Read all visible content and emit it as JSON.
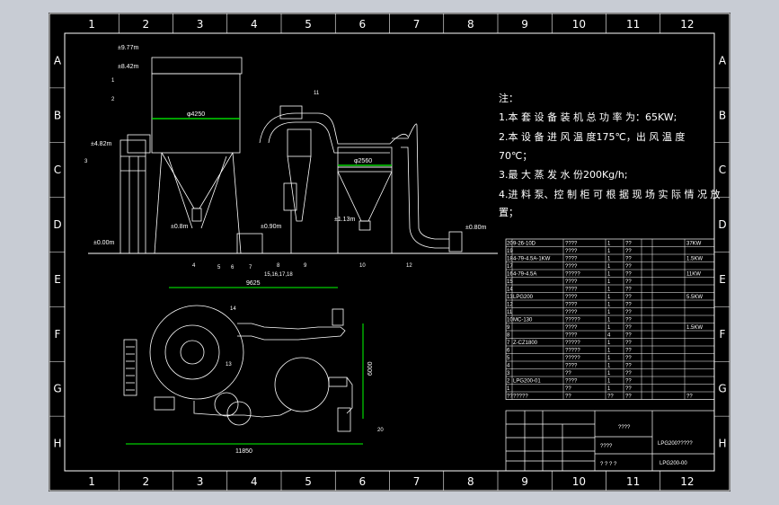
{
  "border": {
    "columns": [
      "1",
      "2",
      "3",
      "4",
      "5",
      "6",
      "7",
      "8",
      "9",
      "10",
      "11",
      "12"
    ],
    "rows": [
      "A",
      "B",
      "C",
      "D",
      "E",
      "F",
      "G",
      "H"
    ]
  },
  "elevations": {
    "e977": "±9.77m",
    "e842": "±8.42m",
    "e482": "±4.82m",
    "e000": "±0.00m",
    "e08a": "±0.8m",
    "e090": "±0.90m",
    "e113": "±1.13m",
    "e080": "±0.80m"
  },
  "dimensions": {
    "dia_dryer": "φ4250",
    "dia_tank": "φ2560",
    "len_top": "9625",
    "len_bottom": "11850",
    "height_side": "6000"
  },
  "callouts": {
    "c1a": "1",
    "c2": "2",
    "c3": "3",
    "c4": "4",
    "c5": "5",
    "c6": "6",
    "c7": "7",
    "c8": "8",
    "c9": "9",
    "c10": "10",
    "c11": "11",
    "c12": "12",
    "c13": "13",
    "c14": "14",
    "c15_18": "15,16,17,18",
    "c20": "20"
  },
  "notes": {
    "heading": "注：",
    "n1": "1.本 套 设 备 装 机 总 功 率 为：65KW;",
    "n2a": "2.本 设 备 进 风 温 度175℃，出 风 温 度",
    "n2b": "70℃；",
    "n3": "3.最 大 蒸 发 水 份200Kg/h;",
    "n4a": "4.进 料 泵、控 制 柜 可 根 据 现 场 实 际 情 况 放",
    "n4b": "置；"
  },
  "parts": [
    {
      "no": "20",
      "code": "9-26-10D",
      "name": "????",
      "qty": "1",
      "mat": "??",
      "note": "37KW"
    },
    {
      "no": "19",
      "code": "",
      "name": "????",
      "qty": "1",
      "mat": "??",
      "note": ""
    },
    {
      "no": "18",
      "code": "4-79-4.5A-1KW",
      "name": "????",
      "qty": "1",
      "mat": "??",
      "note": "1.5KW"
    },
    {
      "no": "17",
      "code": "",
      "name": "????",
      "qty": "1",
      "mat": "??",
      "note": ""
    },
    {
      "no": "16",
      "code": "4-79-4.5A",
      "name": "?????",
      "qty": "1",
      "mat": "??",
      "note": "11KW"
    },
    {
      "no": "15",
      "code": "",
      "name": "????",
      "qty": "1",
      "mat": "??",
      "note": ""
    },
    {
      "no": "14",
      "code": "",
      "name": "????",
      "qty": "1",
      "mat": "??",
      "note": ""
    },
    {
      "no": "13",
      "code": "LPG200",
      "name": "????",
      "qty": "1",
      "mat": "??",
      "note": "5.5KW"
    },
    {
      "no": "12",
      "code": "",
      "name": "????",
      "qty": "1",
      "mat": "??",
      "note": ""
    },
    {
      "no": "11",
      "code": "",
      "name": "????",
      "qty": "1",
      "mat": "??",
      "note": ""
    },
    {
      "no": "10",
      "code": "MC-130",
      "name": "?????",
      "qty": "1",
      "mat": "??",
      "note": ""
    },
    {
      "no": "9",
      "code": "",
      "name": "????",
      "qty": "1",
      "mat": "??",
      "note": "1.5KW"
    },
    {
      "no": "8",
      "code": "",
      "name": "????",
      "qty": "4",
      "mat": "??",
      "note": ""
    },
    {
      "no": "7",
      "code": "Z-CZ1800",
      "name": "?????",
      "qty": "1",
      "mat": "??",
      "note": ""
    },
    {
      "no": "6",
      "code": "",
      "name": "?????",
      "qty": "1",
      "mat": "??",
      "note": ""
    },
    {
      "no": "5",
      "code": "",
      "name": "?????",
      "qty": "1",
      "mat": "??",
      "note": ""
    },
    {
      "no": "4",
      "code": "",
      "name": "????",
      "qty": "1",
      "mat": "??",
      "note": ""
    },
    {
      "no": "3",
      "code": "",
      "name": "??",
      "qty": "1",
      "mat": "??",
      "note": ""
    },
    {
      "no": "2",
      "code": "LPG200-01",
      "name": "????",
      "qty": "1",
      "mat": "??",
      "note": ""
    },
    {
      "no": "1",
      "code": "",
      "name": "??",
      "qty": "1",
      "mat": "??",
      "note": ""
    }
  ],
  "parts_header": [
    "??",
    "?????",
    "??",
    "??",
    "??",
    "??",
    "??",
    "??"
  ],
  "title_block": {
    "company": "????",
    "drawing_name": "LPG200?????",
    "drawing_no": "LPG200-00",
    "scale_label": "????",
    "sheet_marks": "?  ?  ?  ?"
  },
  "colors": {
    "background": "#000000",
    "linework": "#ffffff",
    "highlight": "#00ff00",
    "frame_outer": "#c8ccd4"
  }
}
